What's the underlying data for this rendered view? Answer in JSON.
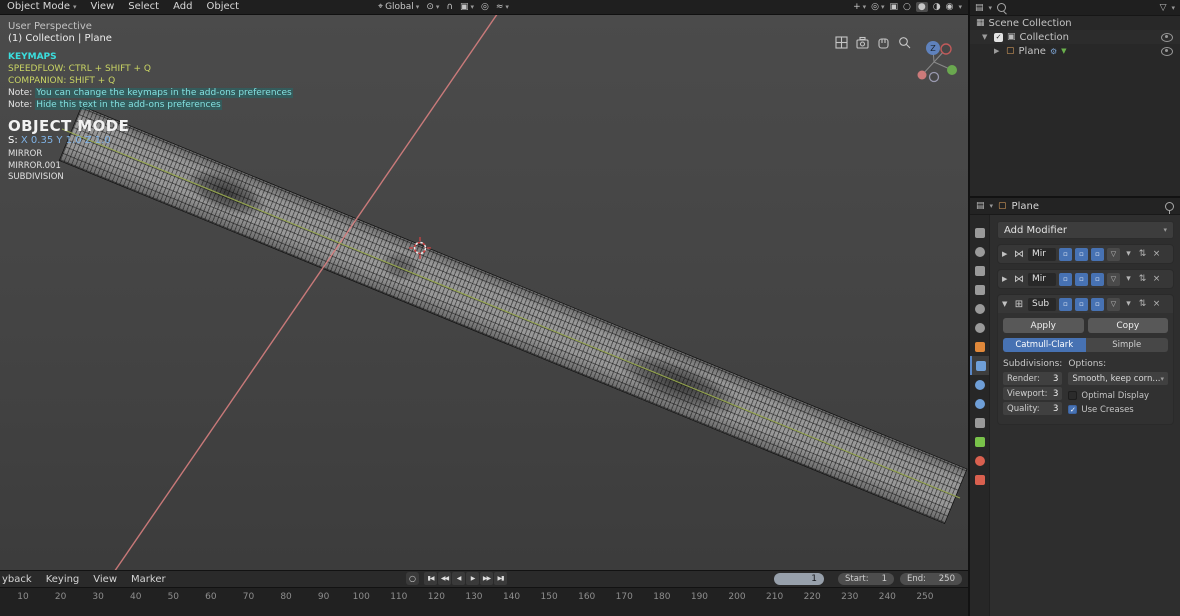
{
  "topbar": {
    "mode_label": "Object Mode",
    "menus": [
      "View",
      "Select",
      "Add",
      "Object"
    ],
    "orientation": "Global"
  },
  "icons": {
    "chevron_down": "▾",
    "caret_right": "▶",
    "caret_down": "▼",
    "menu_editor": "▤",
    "filter_funnel": "▽",
    "mirror_modifier": "⋈",
    "subsurf_modifier": "⊞",
    "move_updown": "⇅",
    "close": "×",
    "display_cage": "▽",
    "check": "✓",
    "orientation": "⌖",
    "pivot": "⊙",
    "snap_magnet": "∩",
    "snap_target": "▣",
    "proportional": "◎",
    "falloff": "≈",
    "gizmo_toggle": "+",
    "overlay_toggle": "◎",
    "xray_toggle": "▣",
    "shading_wireframe": "○",
    "shading_solid": "●",
    "shading_material": "◑",
    "shading_rendered": "◉",
    "scene_collection": "▦",
    "collection": "▣",
    "object": "▢",
    "mesh_data": "▼",
    "modifier_gear": "⚙",
    "record_dot": "○"
  },
  "viewport": {
    "overlay": {
      "perspective": "User Perspective",
      "breadcrumb": "(1) Collection | Plane",
      "keymaps_title": "KEYMAPS",
      "speedflow": "SPEEDFLOW: CTRL + SHIFT + Q",
      "companion": "COMPANION: SHIFT + Q",
      "note1_label": "Note: ",
      "note1_text": "You can change the keymaps in the add-ons preferences",
      "note2_label": "Note: ",
      "note2_text": "Hide this text in the add-ons preferences",
      "mode_hud": "OBJECT MODE",
      "scale_label": "S: ",
      "scale_x": "X 0.35 ",
      "scale_y": "Y 1.0 ",
      "scale_z": "Z 1.0",
      "modifier_list": [
        "MIRROR",
        "MIRROR.001",
        "SUBDIVISION"
      ],
      "gizmo_z_label": "Z"
    }
  },
  "outliner": {
    "scene": "Scene Collection",
    "collection": "Collection",
    "object": "Plane"
  },
  "properties": {
    "breadcrumb_object": "Plane",
    "add_modifier": "Add Modifier",
    "modifiers": [
      {
        "name": "Mir"
      },
      {
        "name": "Mir"
      },
      {
        "name": "Sub"
      }
    ],
    "apply": "Apply",
    "copy": "Copy",
    "catmull": "Catmull-Clark",
    "simple": "Simple",
    "subdivisions_label": "Subdivisions:",
    "options_label": "Options:",
    "fields": [
      {
        "label": "Render:",
        "value": "3"
      },
      {
        "label": "Viewport:",
        "value": "3"
      },
      {
        "label": "Quality:",
        "value": "3"
      }
    ],
    "uv_smooth": "Smooth, keep corn...",
    "optimal_display": "Optimal Display",
    "use_creases": "Use Creases",
    "tabs": [
      {
        "name": "tool",
        "color": "#9a9a9a",
        "shape": "square"
      },
      {
        "name": "render",
        "color": "#9a9a9a",
        "shape": "circle"
      },
      {
        "name": "output",
        "color": "#9a9a9a",
        "shape": "square"
      },
      {
        "name": "view-layer",
        "color": "#9a9a9a",
        "shape": "square"
      },
      {
        "name": "scene",
        "color": "#9a9a9a",
        "shape": "circle"
      },
      {
        "name": "world",
        "color": "#9a9a9a",
        "shape": "circle"
      },
      {
        "name": "object",
        "color": "#e0883a",
        "shape": "square"
      },
      {
        "name": "modifiers",
        "color": "#6f9fd8",
        "shape": "square",
        "active": true
      },
      {
        "name": "particles",
        "color": "#6f9fd8",
        "shape": "circle"
      },
      {
        "name": "physics",
        "color": "#6f9fd8",
        "shape": "circle"
      },
      {
        "name": "constraints",
        "color": "#9a9a9a",
        "shape": "square"
      },
      {
        "name": "object-data",
        "color": "#79c24a",
        "shape": "square"
      },
      {
        "name": "material",
        "color": "#d9604f",
        "shape": "circle"
      },
      {
        "name": "texture",
        "color": "#d9604f",
        "shape": "square"
      }
    ]
  },
  "timeline": {
    "menus": [
      "yback",
      "Keying",
      "View",
      "Marker"
    ],
    "frame": "1",
    "start_label": "Start:",
    "start_value": "1",
    "end_label": "End:",
    "end_value": "250",
    "transport": [
      {
        "name": "jump-to-start",
        "glyph": "▮◀"
      },
      {
        "name": "prev-keyframe",
        "glyph": "◀◀"
      },
      {
        "name": "play-reverse",
        "glyph": "◀"
      },
      {
        "name": "play",
        "glyph": "▶"
      },
      {
        "name": "next-keyframe",
        "glyph": "▶▶"
      },
      {
        "name": "jump-to-end",
        "glyph": "▶▮"
      }
    ],
    "ruler": [
      "10",
      "20",
      "30",
      "40",
      "50",
      "60",
      "70",
      "80",
      "90",
      "100",
      "110",
      "120",
      "130",
      "140",
      "150",
      "160",
      "170",
      "180",
      "190",
      "200",
      "210",
      "220",
      "230",
      "240",
      "250"
    ]
  },
  "colors": {
    "accent": "#4772b3",
    "axis_x": "#e08383",
    "axis_y": "#98a94f"
  }
}
